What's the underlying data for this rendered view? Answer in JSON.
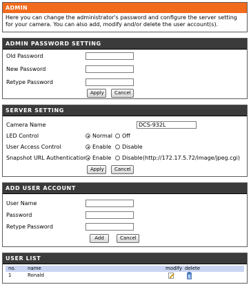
{
  "admin": {
    "title": "ADMIN",
    "intro": "Here you can change the administrator's password and configure the server setting for your camera. You can also add, modify and/or delete the user account(s)."
  },
  "admin_password": {
    "title": "ADMIN PASSWORD SETTING",
    "old_label": "Old Password",
    "new_label": "New Password",
    "retype_label": "Retype Password",
    "apply_label": "Apply",
    "cancel_label": "Cancel"
  },
  "server": {
    "title": "SERVER SETTING",
    "camera_name_label": "Camera Name",
    "camera_name_value": "DCS-932L",
    "led_label": "LED Control",
    "led_normal": "Normal",
    "led_off": "Off",
    "uac_label": "User Access Control",
    "uac_enable": "Enable",
    "uac_disable": "Disable",
    "snap_label": "Snapshot URL Authentication",
    "snap_enable": "Enable",
    "snap_disable": "Disable",
    "snap_url": "(http://172.17.5.72/image/jpeg.cgi)",
    "apply_label": "Apply",
    "cancel_label": "Cancel"
  },
  "add_user": {
    "title": "ADD USER ACCOUNT",
    "username_label": "User Name",
    "password_label": "Password",
    "retype_label": "Retype Password",
    "add_label": "Add",
    "cancel_label": "Cancel"
  },
  "user_list": {
    "title": "USER LIST",
    "col_no": "no.",
    "col_name": "name",
    "col_modify": "modify",
    "col_delete": "delete",
    "rows": [
      {
        "no": "1",
        "name": "Ronald"
      }
    ]
  },
  "colors": {
    "orange_header": "#f26b1d",
    "dark_header": "#3b3b3b",
    "list_header": "#c9d5f2"
  }
}
